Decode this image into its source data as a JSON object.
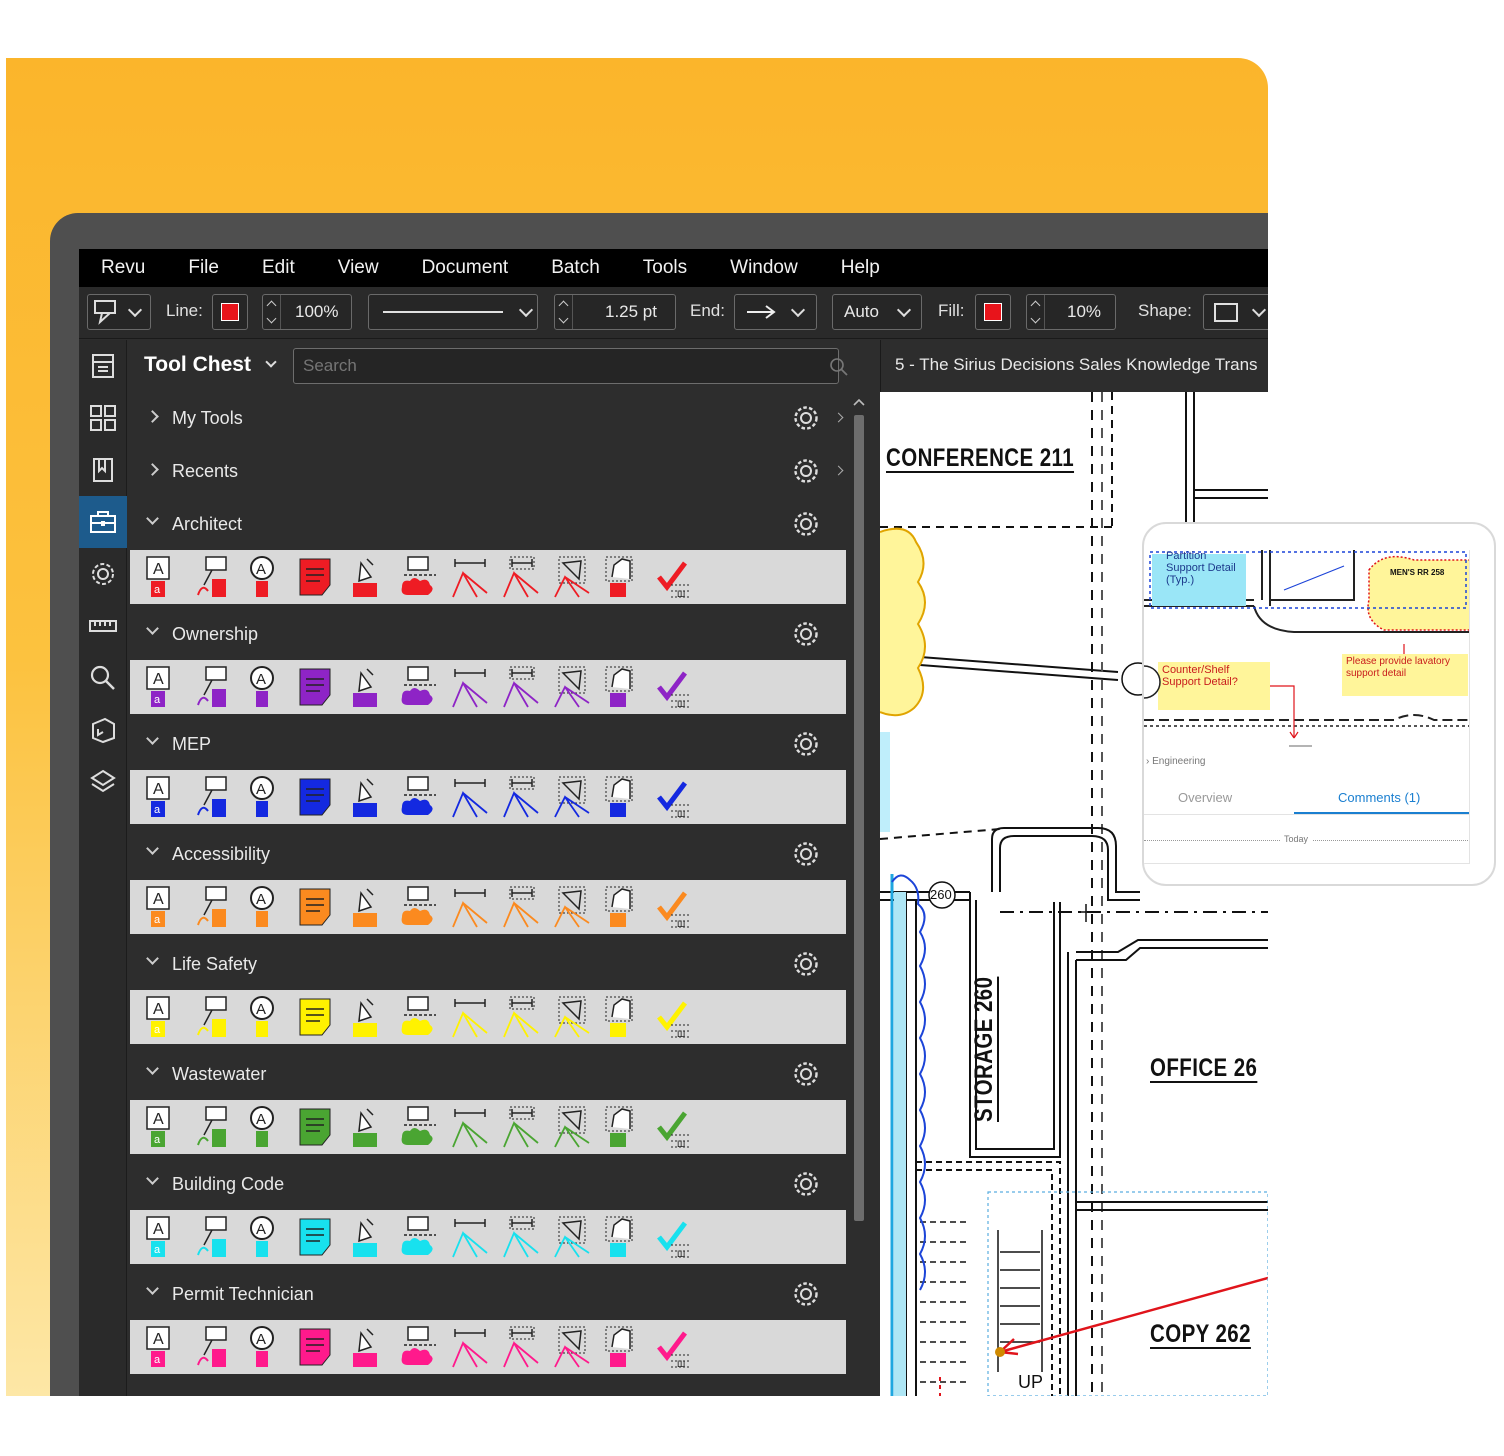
{
  "menu": [
    "Revu",
    "File",
    "Edit",
    "View",
    "Document",
    "Batch",
    "Tools",
    "Window",
    "Help"
  ],
  "toolbar": {
    "line_label": "Line:",
    "line_color": "#e8141b",
    "opacity_value": "100%",
    "width_value": "1.25 pt",
    "end_label": "End:",
    "auto_value": "Auto",
    "fill_label": "Fill:",
    "fill_color": "#e8141b",
    "fill_opacity": "10%",
    "shape_label": "Shape:"
  },
  "rail": [
    "panel-icon",
    "thumbnails-icon",
    "bookmarks-icon",
    "toolbox-icon",
    "settings-icon",
    "ruler-icon",
    "search-icon",
    "markup-icon",
    "layers-icon"
  ],
  "tool_chest": {
    "title": "Tool Chest",
    "search_placeholder": "Search",
    "collapsed": [
      {
        "label": "My Tools"
      },
      {
        "label": "Recents"
      }
    ],
    "sets": [
      {
        "label": "Architect",
        "color": "#ee1c24"
      },
      {
        "label": "Ownership",
        "color": "#8e24c6"
      },
      {
        "label": "MEP",
        "color": "#1429e0"
      },
      {
        "label": "Accessibility",
        "color": "#fb8a1f"
      },
      {
        "label": "Life Safety",
        "color": "#fff200"
      },
      {
        "label": "Wastewater",
        "color": "#4aa532"
      },
      {
        "label": "Building Code",
        "color": "#18e1ee"
      },
      {
        "label": "Permit Technician",
        "color": "#ff1a8c"
      }
    ]
  },
  "document": {
    "tab_title": "5 - The Sirius Decisions Sales Knowledge Trans",
    "rooms": {
      "conference": "CONFERENCE  211",
      "storage": "STORAGE  260",
      "office": "OFFICE  26",
      "copy": "COPY  262",
      "up": "UP",
      "tag_260": "260"
    }
  },
  "phone": {
    "callout1": "Partition Support Detail (Typ.)",
    "callout2": "Counter/Shelf Support Detail?",
    "callout3": "Please provide lavatory support detail",
    "room_tag": "MEN'S RR  258",
    "section": "Engineering",
    "tab_overview": "Overview",
    "tab_comments": "Comments (1)",
    "today": "Today"
  }
}
